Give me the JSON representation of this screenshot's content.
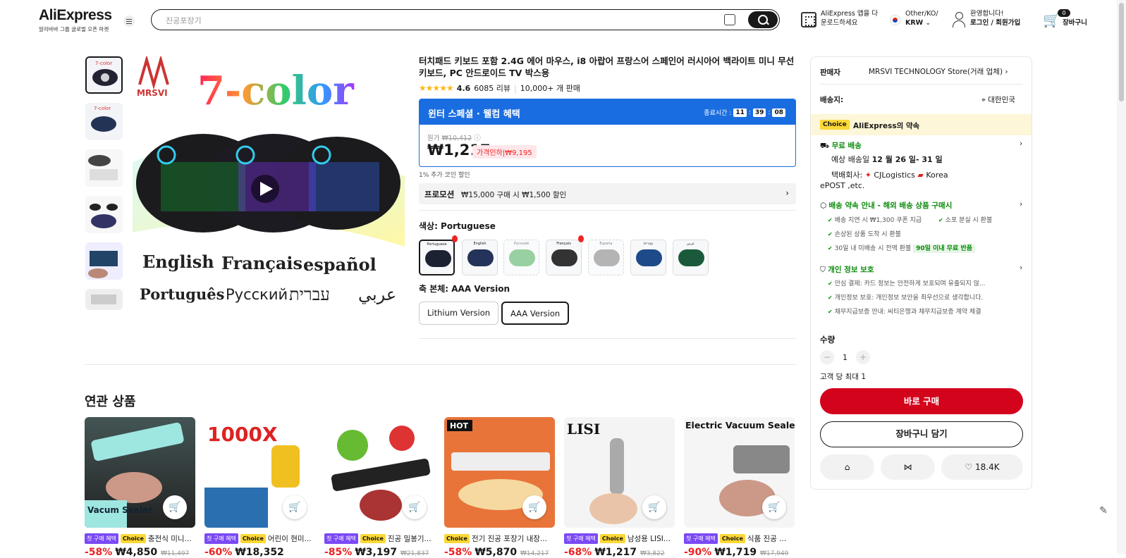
{
  "header": {
    "logo": "AliExpress",
    "logo_sub": "알리바바 그룹 글로벌 오픈 마켓",
    "search_placeholder": "진공포장기",
    "app_line1": "AliExpress 앱을 다",
    "app_line2": "운로드하세요",
    "region_line1": "Other/KO/",
    "region_line2": "KRW",
    "user_line1": "환영합니다!",
    "user_line2": "로그인 / 회원가입",
    "cart_count": "0",
    "cart_label": "장바구니"
  },
  "product": {
    "title": "터치패드 키보드 포함 2.4G 에어 마우스, i8 아랍어 프랑스어 스페인어 러시아어 백라이트 미니 무선 키보드, PC 안드로이드 TV 박스용",
    "rating": "4.6",
    "reviews": "6085 리뷰",
    "sold": "10,000+ 개 판매",
    "promo_title": "윈터 스페셜 · 웰컴 혜택",
    "countdown_label": "종료시간 :",
    "countdown_h": "11",
    "countdown_m": "39",
    "countdown_s": "08",
    "orig_label": "원가",
    "orig_price": "₩10,412",
    "price": "₩1,217",
    "price_drop": "가격인하|₩9,195",
    "coin": "1% 추가 코인 할인",
    "promotion_label": "프로모션",
    "promotion_text": "₩15,000 구매 시 ₩1,500 할인",
    "color_label": "색상: Portuguese",
    "color_options": [
      "Portuguese",
      "English",
      "Русский",
      "Français",
      "España",
      "עברית",
      "عربي"
    ],
    "version_label": "축 본체: AAA Version",
    "version_options": [
      "Lithium Version",
      "AAA Version"
    ],
    "image_texts": {
      "brand": "MRSVI",
      "headline": "7-color",
      "lang1": "English",
      "lang2": "Français",
      "lang3": "español",
      "lang4": "Português",
      "lang5": "Русский",
      "lang6": "עברית",
      "lang7": "عربي"
    }
  },
  "related": {
    "title": "연관 상품",
    "first_tag": "첫 구매 혜택",
    "choice_tag": "Choice",
    "items": [
      {
        "name": "충전식 미니...",
        "pct": "-58%",
        "price": "₩4,850",
        "orig": "₩11,497",
        "img_text": "Vacum Sealer",
        "first": true
      },
      {
        "name": "어린이 현미...",
        "pct": "-60%",
        "price": "₩18,352",
        "orig": "",
        "img_text": "1000X",
        "first": true
      },
      {
        "name": "진공 밀봉기...",
        "pct": "-85%",
        "price": "₩3,197",
        "orig": "₩21,837",
        "img_text": "",
        "first": true
      },
      {
        "name": "전기 진공 포장기 내장...",
        "pct": "-58%",
        "price": "₩5,870",
        "orig": "₩14,217",
        "img_text": "HOT",
        "first": false
      },
      {
        "name": "남성용 LISI...",
        "pct": "-68%",
        "price": "₩1,217",
        "orig": "₩3,822",
        "img_text": "LISI",
        "first": true
      },
      {
        "name": "식품 진공 ...",
        "pct": "-90%",
        "price": "₩1,719",
        "orig": "₩17,949",
        "img_text": "Electric Vacuum Sealer",
        "first": true
      }
    ]
  },
  "panel": {
    "seller_label": "판매자",
    "seller_name": "MRSVI TECHNOLOGY Store(거래 업체)",
    "ship_to_label": "배송지:",
    "ship_to": "대한민국",
    "choice_badge": "Choice",
    "choice_text": "AliExpress의 약속",
    "free_ship": "무료 배송",
    "eta_prefix": "예상 배송일",
    "eta": "12 월 26 일- 31 일",
    "carrier_prefix": "택배회사:",
    "carrier1": "CJLogistics",
    "carrier2": "Korea",
    "carrier3": "ePOST ,etc.",
    "guarantee_title": "배송 약속 안내 - 해외 배송 상품 구매시",
    "g1": "배송 지연 시 ₩1,300 쿠폰 지급",
    "g2": "소포 분실 시 환불",
    "g3": "손상된 상품 도착 시 환불",
    "g4": "30일 내 미배송 시 전액 환불",
    "g4_badge": "90일 이내 무료 반품",
    "privacy_title": "개인 정보 보호",
    "p1": "안심 결제: 카드 정보는 안전하게 보호되며 유출되지 않...",
    "p2": "개인정보 보호: 개인정보 보안을 최우선으로 생각합니다.",
    "p3": "채무지급보증 안내: 씨티은행과 채무지급보증 계약 체결",
    "qty_label": "수량",
    "qty_value": "1",
    "qty_limit": "고객 당 최대 1",
    "buy_now": "바로 구매",
    "add_cart": "장바구니 담기",
    "wishlist_count": "18.4K"
  }
}
